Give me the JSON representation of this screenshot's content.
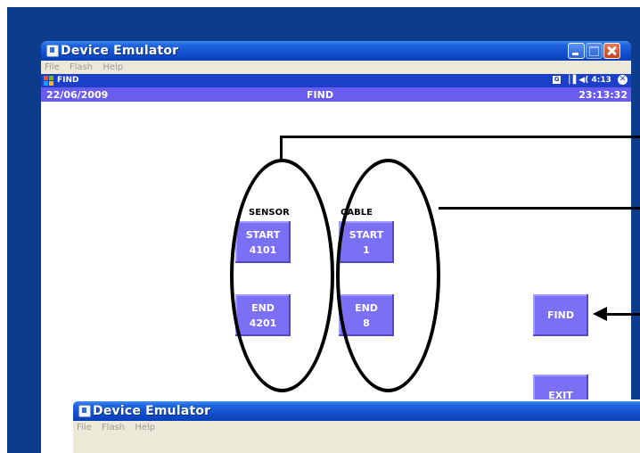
{
  "window": {
    "title": "Device Emulator",
    "menu": [
      "File",
      "Flash",
      "Help"
    ]
  },
  "device": {
    "top_title": "FIND",
    "status_time": "4:13",
    "date": "22/06/2009",
    "screen_title": "FIND",
    "clock": "23:13:32"
  },
  "sensor": {
    "label": "SENSOR",
    "start_label": "START",
    "start_value": "4101",
    "end_label": "END",
    "end_value": "4201"
  },
  "cable": {
    "label": "CABLE",
    "start_label": "START",
    "start_value": "1",
    "end_label": "END",
    "end_value": "8"
  },
  "actions": {
    "find": "FIND",
    "exit": "EXIT"
  },
  "second_window": {
    "title": "Device Emulator",
    "menu": [
      "File",
      "Flash",
      "Help"
    ]
  },
  "colors": {
    "desktop": "#0e3c8c",
    "button": "#7b6ff6",
    "infobar": "#6b5cf0"
  }
}
